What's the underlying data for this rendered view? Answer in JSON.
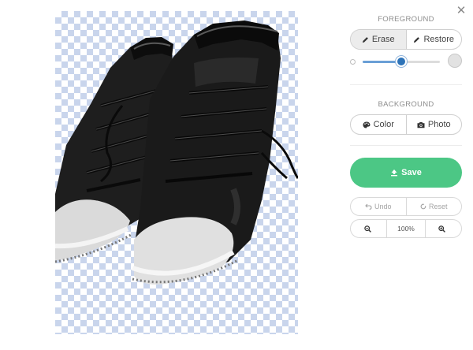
{
  "foreground": {
    "label": "FOREGROUND",
    "erase_label": "Erase",
    "restore_label": "Restore",
    "active_mode": "Erase",
    "brush_size_level": 0.5
  },
  "background": {
    "label": "BACKGROUND",
    "color_label": "Color",
    "photo_label": "Photo"
  },
  "save_label": "Save",
  "history": {
    "undo_label": "Undo",
    "reset_label": "Reset"
  },
  "zoom": {
    "level": "100%"
  },
  "icons": {
    "close": "close-icon",
    "erase": "pencil-icon",
    "restore": "pencil-icon",
    "color": "palette-icon",
    "photo": "camera-icon",
    "save": "upload-icon",
    "undo": "undo-icon",
    "reset": "reset-icon",
    "zoom_out": "zoom-out-icon",
    "zoom_in": "zoom-in-icon"
  },
  "colors": {
    "save_button": "#4cc785",
    "slider_thumb": "#2e73b8",
    "checker": "#c9d5ec"
  }
}
